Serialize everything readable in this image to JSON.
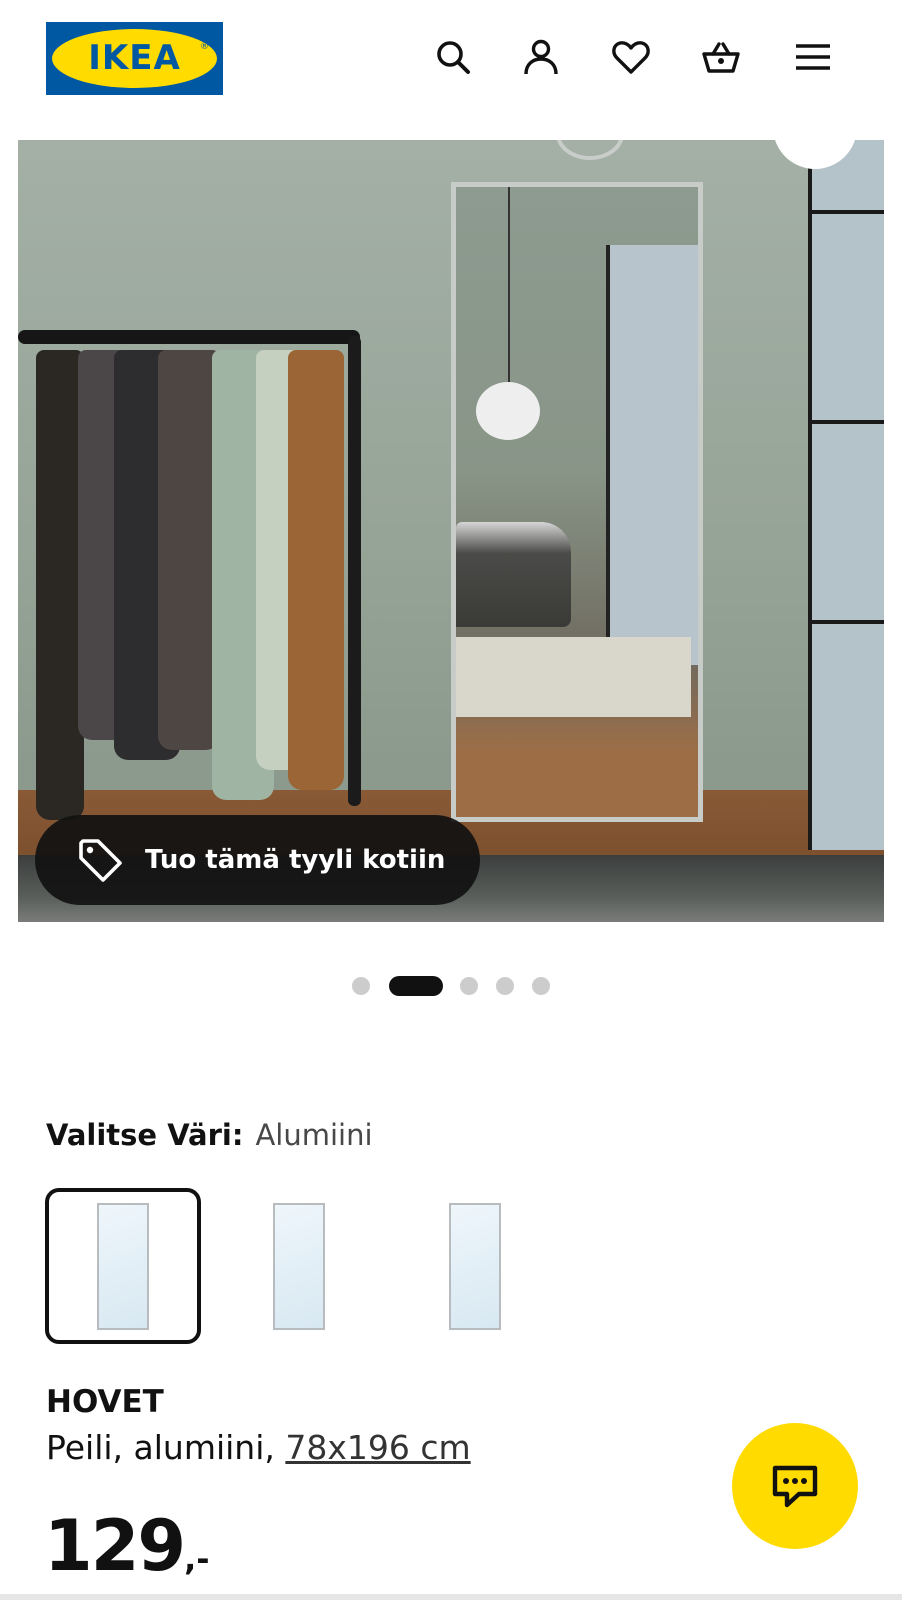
{
  "header": {
    "logo_text": "IKEA",
    "icons": [
      "search-icon",
      "account-icon",
      "heart-icon",
      "basket-icon",
      "menu-icon"
    ]
  },
  "hero": {
    "shop_the_look_label": "Tuo tämä tyyli kotiin",
    "carousel": {
      "total": 5,
      "active_index": 1
    }
  },
  "color_selector": {
    "label": "Valitse Väri:",
    "selected_value": "Alumiini",
    "swatch_count": 3,
    "selected_index": 0
  },
  "product": {
    "name": "HOVET",
    "description": "Peili, alumiini, ",
    "size_link": "78x196 cm",
    "price": "129",
    "price_suffix": ",-"
  },
  "colors": {
    "brand_blue": "#0058a3",
    "brand_yellow": "#ffdb00",
    "text": "#111111"
  }
}
